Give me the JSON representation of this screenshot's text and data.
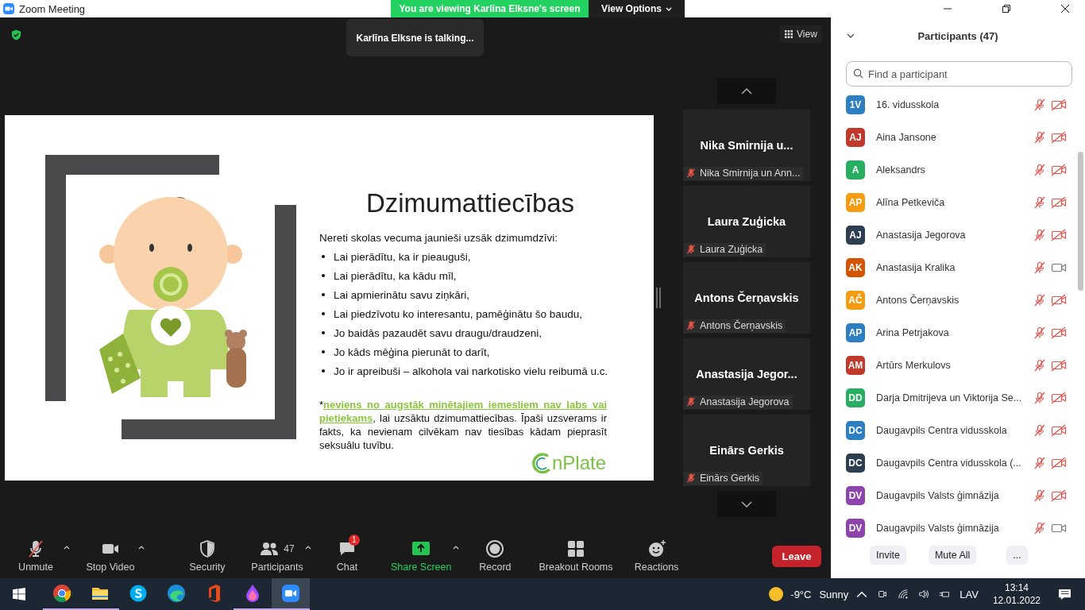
{
  "window": {
    "title": "Zoom Meeting"
  },
  "share_banner": {
    "text": "You are viewing Karlīna Elksne's screen",
    "button": "View Options"
  },
  "stage": {
    "talking": "Karlīna Elksne is talking...",
    "view_button": "View"
  },
  "slide": {
    "title": "Dzimumattiecības",
    "intro": "Nereti skolas vecuma jaunieši uzsāk dzimumdzīvi:",
    "bullets": [
      "Lai pierādītu, ka ir pieauguši,",
      "Lai pierādītu, ka kādu mīl,",
      "Lai apmierinātu savu ziņkāri,",
      "Lai piedzīvotu ko interesantu, pamēģinātu šo baudu,",
      "Jo baidās pazaudēt savu draugu/draudzeni,",
      "Jo kāds mēģina pierunāt to darīt,",
      "Jo ir apreibuši – alkohola vai narkotisko vielu reibumā u.c."
    ],
    "note": {
      "mark": "*",
      "emphasis": "neviens no augstāk minētajiem iemesliem nav labs vai pietiekams",
      "rest": ", lai uzsāktu dzimumattiecības. Īpaši uzsverams ir fakts, ka nevienam cilvēkam nav tiesības kādam pieprasīt seksuālu tuvību."
    },
    "logo": "nPlate"
  },
  "thumbnails": [
    {
      "title": "Nika Smirnija u...",
      "name": "Nika Smirnija un Ann...",
      "muted": true
    },
    {
      "title": "Laura Zuģicka",
      "name": "Laura Zuģicka",
      "muted": true
    },
    {
      "title": "Antons Čerņavskis",
      "name": "Antons Čerņavskis",
      "muted": true
    },
    {
      "title": "Anastasija Jegor...",
      "name": "Anastasija Jegorova",
      "muted": true
    },
    {
      "title": "Einārs Gerkis",
      "name": "Einārs Gerkis",
      "muted": true
    }
  ],
  "participants_panel": {
    "title": "Participants (47)",
    "search": {
      "placeholder": "Find a participant"
    },
    "participants": [
      {
        "initials": "1V",
        "color": "#2d7fc1",
        "name": "16. vidusskola",
        "mic_muted": true,
        "video_off": true
      },
      {
        "initials": "AJ",
        "color": "#c0392b",
        "name": "Aina Jansone",
        "mic_muted": true,
        "video_off": true
      },
      {
        "initials": "A",
        "color": "#27ae60",
        "name": "Aleksandrs",
        "mic_muted": true,
        "video_off": true
      },
      {
        "initials": "AP",
        "color": "#f39c12",
        "name": "Alīna Petkeviča",
        "mic_muted": true,
        "video_off": true
      },
      {
        "initials": "AJ",
        "color": "#2c3e50",
        "name": "Anastasija Jegorova",
        "mic_muted": true,
        "video_off": true
      },
      {
        "initials": "AK",
        "color": "#d35400",
        "name": "Anastasija Kralika",
        "mic_muted": true,
        "video_off": false
      },
      {
        "initials": "AČ",
        "color": "#f39c12",
        "name": "Antons Čerņavskis",
        "mic_muted": true,
        "video_off": true
      },
      {
        "initials": "AP",
        "color": "#2d7fc1",
        "name": "Arina Petrjakova",
        "mic_muted": true,
        "video_off": true
      },
      {
        "initials": "AM",
        "color": "#c0392b",
        "name": "Artūrs Merkulovs",
        "mic_muted": true,
        "video_off": true
      },
      {
        "initials": "DD",
        "color": "#27ae60",
        "name": "Darja Dmitrijeva un Viktorija Se...",
        "mic_muted": true,
        "video_off": true
      },
      {
        "initials": "DC",
        "color": "#2d7fc1",
        "name": "Daugavpils Centra vidusskola",
        "mic_muted": true,
        "video_off": true
      },
      {
        "initials": "DC",
        "color": "#2c3e50",
        "name": "Daugavpils Centra vidusskola (...",
        "mic_muted": true,
        "video_off": true
      },
      {
        "initials": "DV",
        "color": "#8e44ad",
        "name": "Daugavpils Valsts ģimnāzija",
        "mic_muted": true,
        "video_off": true
      },
      {
        "initials": "DV",
        "color": "#8e44ad",
        "name": "Daugavpils Valsts ģimnāzija",
        "mic_muted": true,
        "video_off": false
      }
    ],
    "buttons": [
      "Invite",
      "Mute All",
      "..."
    ]
  },
  "toolbar": {
    "items": [
      {
        "kind": "mic",
        "label": "Unmute",
        "caret": true,
        "muted": true
      },
      {
        "kind": "video",
        "label": "Stop Video",
        "caret": true
      },
      {
        "kind": "security",
        "label": "Security",
        "caret": false
      },
      {
        "kind": "participants",
        "label": "Participants",
        "count": "47",
        "caret": true
      },
      {
        "kind": "chat",
        "label": "Chat",
        "badge": "1",
        "caret": false
      },
      {
        "kind": "share",
        "label": "Share Screen",
        "caret": true
      },
      {
        "kind": "record",
        "label": "Record",
        "caret": false
      },
      {
        "kind": "breakout",
        "label": "Breakout Rooms",
        "caret": false
      },
      {
        "kind": "reactions",
        "label": "Reactions",
        "caret": false
      }
    ],
    "leave": "Leave"
  },
  "taskbar": {
    "apps": [
      {
        "kind": "chrome",
        "running": true,
        "selected": false
      },
      {
        "kind": "explorer",
        "running": true,
        "selected": false
      },
      {
        "kind": "skype",
        "running": false,
        "selected": false
      },
      {
        "kind": "edge",
        "running": false,
        "selected": false
      },
      {
        "kind": "office",
        "running": false,
        "selected": false
      },
      {
        "kind": "drop",
        "running": true,
        "selected": false
      },
      {
        "kind": "zoom",
        "running": true,
        "selected": true
      }
    ],
    "temperature": "-9°C",
    "weather": "Sunny",
    "language": "LAV",
    "time": "13:14",
    "date": "12.01.2022"
  }
}
